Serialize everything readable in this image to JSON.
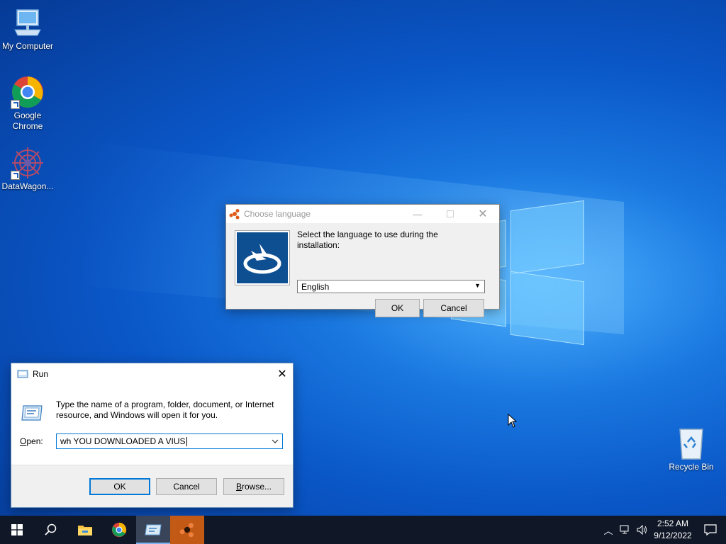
{
  "desktop": {
    "icons": [
      {
        "label": "My Computer",
        "icon": "computer-icon"
      },
      {
        "label": "Google\nChrome",
        "icon": "chrome-icon"
      },
      {
        "label": "DataWagon...",
        "icon": "datawagon-icon"
      },
      {
        "label": "Recycle Bin",
        "icon": "recycle-bin-icon"
      }
    ]
  },
  "language_dialog": {
    "title": "Choose language",
    "prompt": "Select the language to use during the installation:",
    "selected_language": "English",
    "ok_label": "OK",
    "cancel_label": "Cancel"
  },
  "run_dialog": {
    "title": "Run",
    "description": "Type the name of a program, folder, document, or Internet resource, and Windows will open it for you.",
    "open_label_accel": "O",
    "open_label_rest": "pen:",
    "input_value": "wh YOU DOWNLOADED A VIUS",
    "ok_label": "OK",
    "cancel_label": "Cancel",
    "browse_label_accel": "B",
    "browse_label_rest": "rowse..."
  },
  "taskbar": {
    "time": "2:52 AM",
    "date": "9/12/2022"
  },
  "colors": {
    "accent": "#0078d7",
    "taskbar": "#101828",
    "installer_orange": "#c25a16"
  }
}
